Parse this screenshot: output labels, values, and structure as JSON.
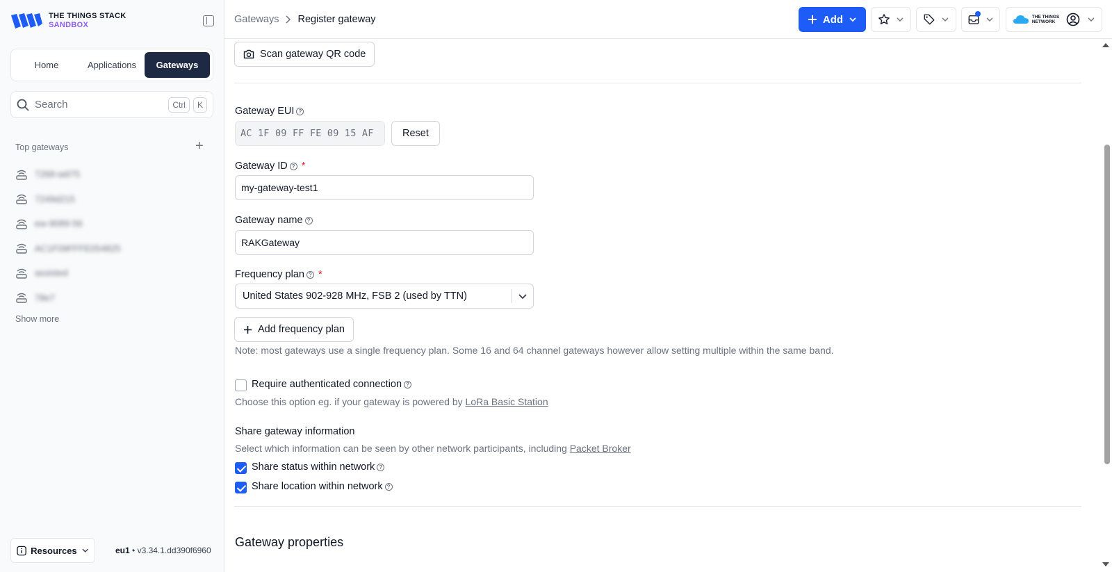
{
  "brand": {
    "line1": "THE THINGS STACK",
    "line2": "SANDBOX"
  },
  "nav": {
    "tabs": [
      "Home",
      "Applications",
      "Gateways"
    ],
    "active": "Gateways"
  },
  "search": {
    "placeholder": "Search",
    "shortcut": [
      "Ctrl",
      "K"
    ]
  },
  "sidebar": {
    "top_gateways_title": "Top gateways",
    "gateways": [
      "7268-ia975",
      "7249d215",
      "ew-9089-56",
      "AC1F09FFFE054825",
      "assisted",
      "78e7"
    ],
    "show_more": "Show more",
    "resources": "Resources",
    "cluster": "eu1",
    "version": "v3.34.1.dd390f6960"
  },
  "header": {
    "breadcrumb": [
      "Gateways",
      "Register gateway"
    ],
    "add_label": "Add",
    "network_logo": [
      "THE THINGS",
      "NETWORK"
    ]
  },
  "form": {
    "scan_qr": "Scan gateway QR code",
    "eui_label": "Gateway EUI",
    "eui_value": "AC 1F 09 FF FE 09 15 AF",
    "reset": "Reset",
    "id_label": "Gateway ID",
    "id_value": "my-gateway-test1",
    "name_label": "Gateway name",
    "name_value": "RAKGateway",
    "freq_label": "Frequency plan",
    "freq_value": "United States 902-928 MHz, FSB 2 (used by TTN)",
    "add_freq": "Add frequency plan",
    "freq_note": "Note: most gateways use a single frequency plan. Some 16 and 64 channel gateways however allow setting multiple within the same band.",
    "auth_label": "Require authenticated connection",
    "auth_checked": false,
    "auth_note_prefix": "Choose this option eg. if your gateway is powered by",
    "auth_note_link": "LoRa Basic Station",
    "share_title": "Share gateway information",
    "share_note_prefix": "Select which information can be seen by other network participants, including",
    "share_note_link": "Packet Broker",
    "share_status": "Share status within network",
    "share_status_checked": true,
    "share_location": "Share location within network",
    "share_location_checked": true,
    "properties_title": "Gateway properties"
  },
  "colors": {
    "primary": "#1d5cf6",
    "nav_active": "#1e2a44",
    "brand_purple": "#8b5cf6",
    "required": "#dc2626"
  }
}
